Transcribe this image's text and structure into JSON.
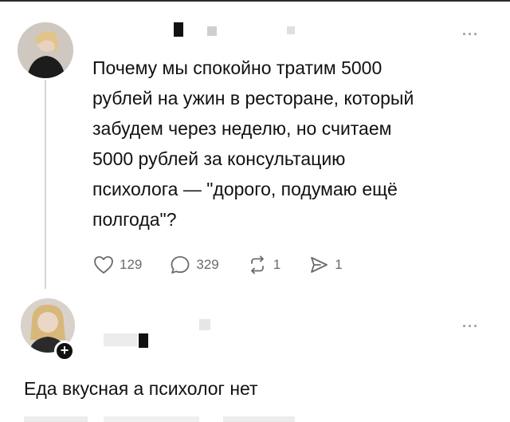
{
  "post": {
    "text": "Почему мы спокойно тратим 5000\nрублей на ужин в ресторане, который\nзабудем через неделю, но считаем\n5000 рублей за консультацию\nпсихолога — \"дорого, подумаю ещё\nполгода\"?",
    "likes": "129",
    "comments": "329",
    "reposts": "1",
    "shares": "1"
  },
  "reply": {
    "text": "Еда вкусная а психолог нет",
    "follow_badge": "+"
  },
  "menu_glyph": "···",
  "colors": {
    "text": "#111111",
    "muted": "#6b6b6b",
    "thread_line": "#d6d6d6",
    "censor": "#1a1a1a"
  }
}
